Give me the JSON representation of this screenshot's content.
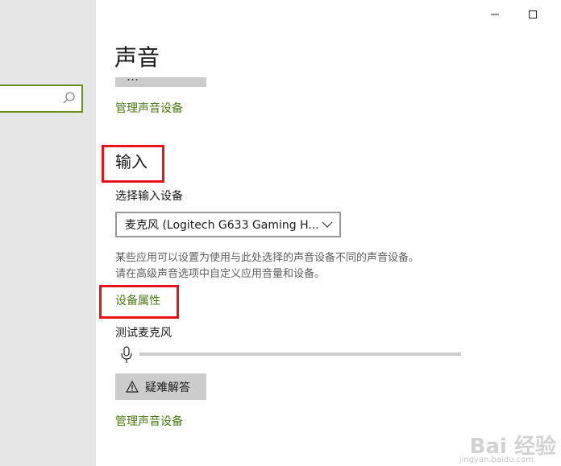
{
  "window": {
    "minimize_glyph": "—",
    "maximize_glyph": "☐"
  },
  "sidebar": {
    "search_placeholder": ""
  },
  "page": {
    "title": "声音",
    "output_clipped_button_label": "…",
    "manage_devices_link_top": "管理声音设备"
  },
  "input_section": {
    "title": "输入",
    "select_label": "选择输入设备",
    "selected_device": "麦克风 (Logitech G633 Gaming H...",
    "description_line1": "某些应用可以设置为使用与此处选择的声音设备不同的声音设备。",
    "description_line2": "请在高级声音选项中自定义应用音量和设备。",
    "device_properties_link": "设备属性",
    "test_mic_label": "测试麦克风",
    "mic_level": 0,
    "troubleshoot_label": "疑难解答",
    "manage_devices_link_bottom": "管理声音设备"
  },
  "watermark": {
    "text": "Bai 经验",
    "sub": "jingyan.baidu.com"
  },
  "colors": {
    "accent_link": "#487a15",
    "highlight_box": "#e8121b",
    "sidebar_bg": "#e6e6e6"
  }
}
